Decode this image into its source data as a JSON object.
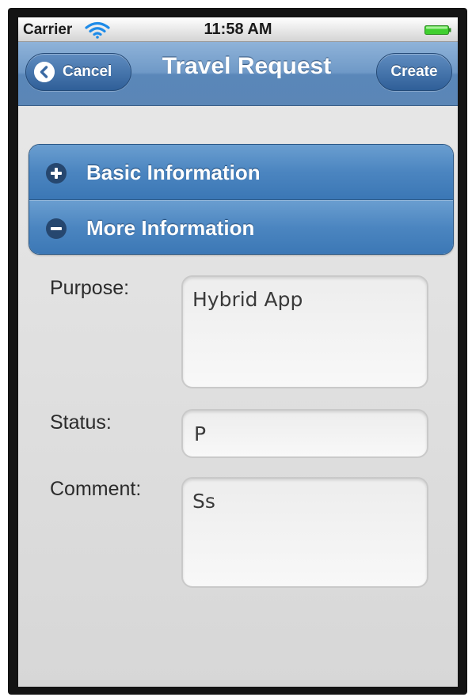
{
  "status_bar": {
    "carrier": "Carrier",
    "time": "11:58 AM",
    "wifi_icon": "wifi-icon",
    "battery_icon": "battery-icon"
  },
  "nav_bar": {
    "title": "Travel Request",
    "cancel_label": "Cancel",
    "create_label": "Create"
  },
  "sections": [
    {
      "label": "Basic Information",
      "icon": "plus-circle-icon",
      "expanded": false
    },
    {
      "label": "More Information",
      "icon": "minus-circle-icon",
      "expanded": true
    }
  ],
  "form": {
    "purpose": {
      "label": "Purpose:",
      "value": "Hybrid App"
    },
    "status": {
      "label": "Status:",
      "value": "P"
    },
    "comment": {
      "label": "Comment:",
      "value": "Ss"
    }
  },
  "colors": {
    "nav_bar": "#6f99c7",
    "section_header": "#4b85c0",
    "battery": "#3fcf2f"
  }
}
